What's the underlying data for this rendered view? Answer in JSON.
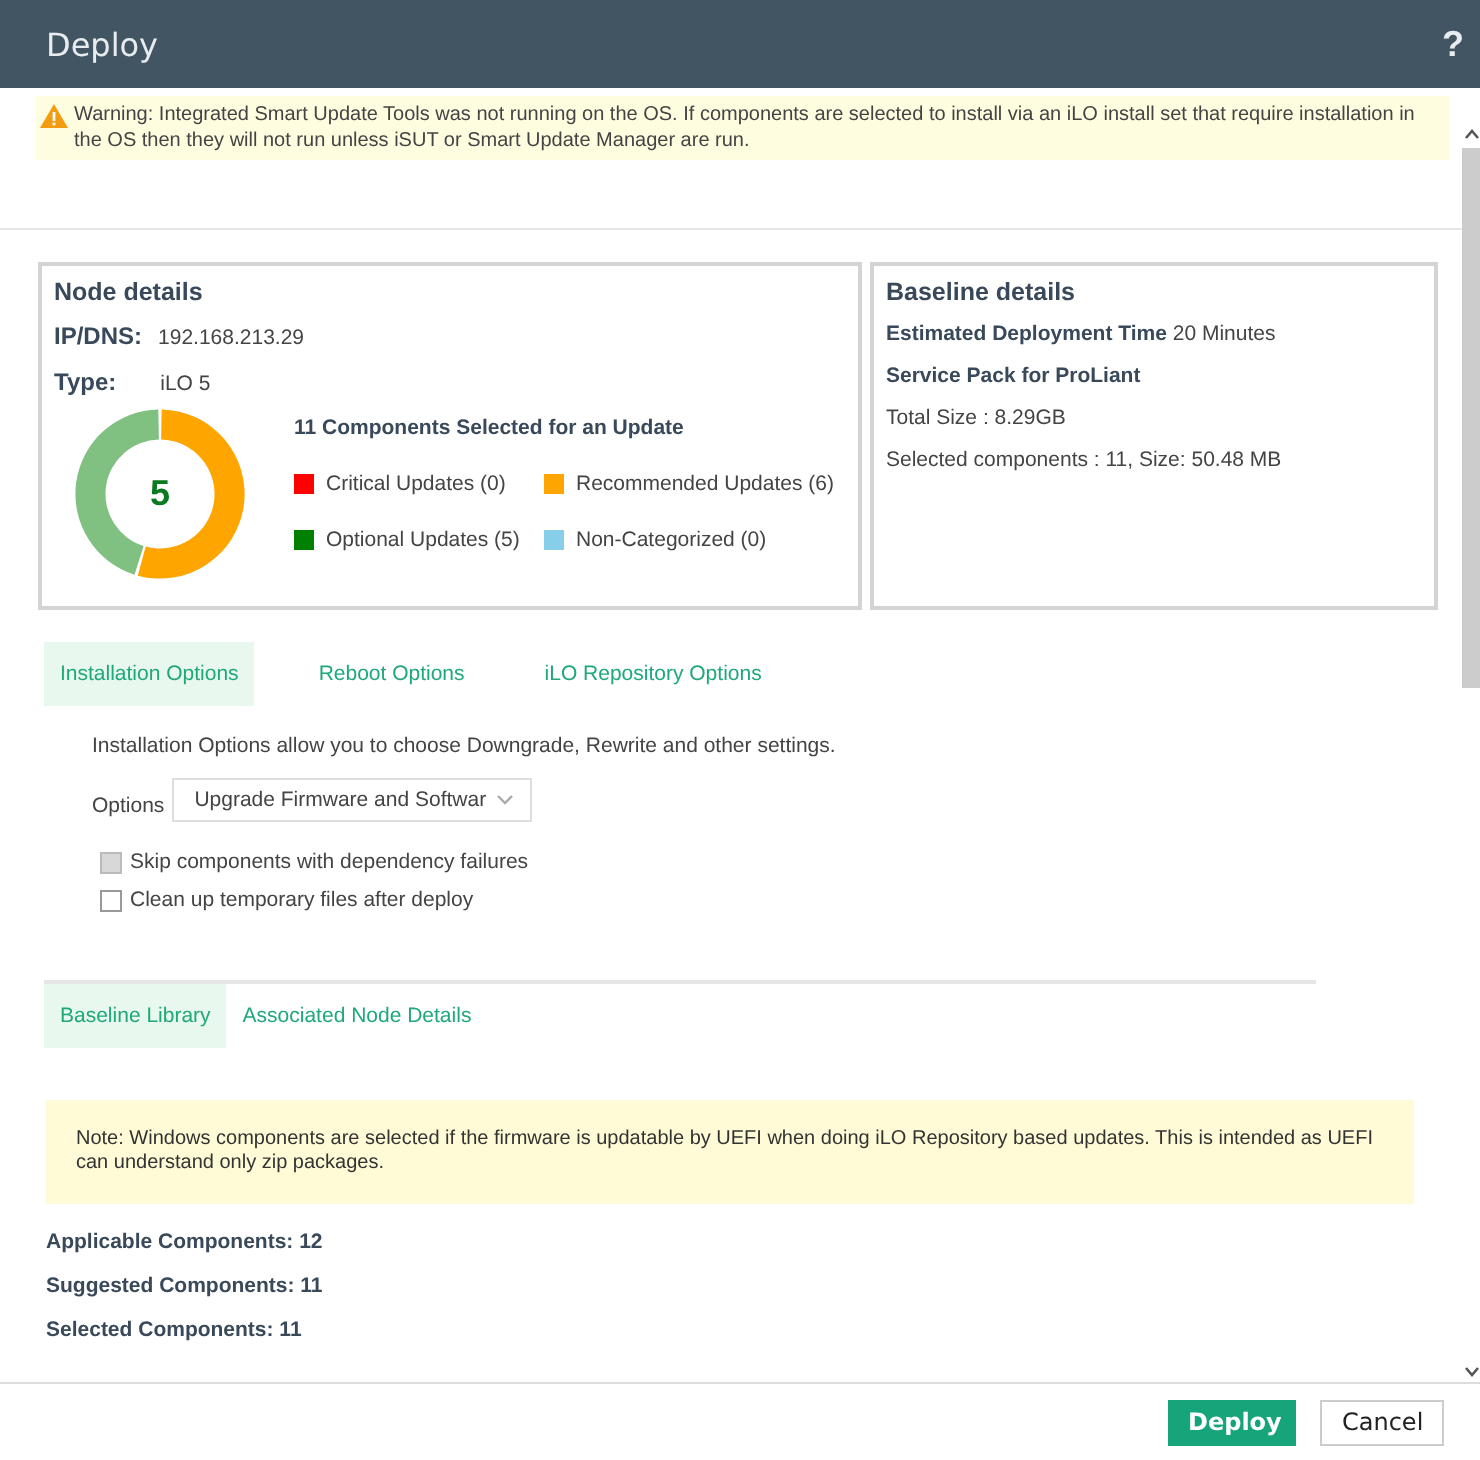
{
  "window": {
    "title": "Deploy",
    "help": "?"
  },
  "warning": "Warning: Integrated Smart Update Tools was not running on the OS. If components are selected to install via an iLO install set that require installation in the OS then they will not run unless iSUT or Smart Update Manager are run.",
  "node_details": {
    "title": "Node details",
    "ip_label": "IP/DNS:",
    "ip": "192.168.213.29",
    "type_label": "Type:",
    "type": "iLO 5",
    "donut_center": "5",
    "summary": "11 Components Selected for an Update",
    "legend": [
      {
        "label": "Critical Updates (0)",
        "color": "#ff0000"
      },
      {
        "label": "Recommended Updates (6)",
        "color": "#ffa500"
      },
      {
        "label": "Optional Updates (5)",
        "color": "#008000"
      },
      {
        "label": "Non-Categorized (0)",
        "color": "#87ceeb"
      }
    ]
  },
  "baseline_details": {
    "title": "Baseline details",
    "lines": [
      {
        "kind": "mixed",
        "label": "Estimated Deployment Time",
        "value": "20 Minutes"
      },
      {
        "kind": "bold",
        "label": "Service Pack for ProLiant"
      },
      {
        "kind": "plain",
        "label": "Total Size : 8.29GB"
      },
      {
        "kind": "plain",
        "label": "Selected components : 11, Size: 50.48 MB"
      }
    ]
  },
  "option_tabs": [
    {
      "label": "Installation Options",
      "selected": true
    },
    {
      "label": "Reboot Options",
      "selected": false
    },
    {
      "label": "iLO Repository Options",
      "selected": false
    }
  ],
  "installation_options": {
    "description": "Installation Options allow you to choose Downgrade, Rewrite and other settings.",
    "options_label": "Options",
    "options_value": "Upgrade Firmware and Softwar",
    "checkboxes": [
      {
        "label": "Skip components with dependency failures",
        "checked": false,
        "disabled": true
      },
      {
        "label": "Clean up temporary files after deploy",
        "checked": false,
        "disabled": false
      }
    ]
  },
  "library_tabs": [
    {
      "label": "Baseline Library",
      "selected": true
    },
    {
      "label": "Associated Node Details",
      "selected": false
    }
  ],
  "note": "Note: Windows components are selected if the firmware is updatable by UEFI when doing iLO Repository based updates. This is intended as UEFI can understand only zip packages.",
  "counts": [
    "Applicable Components: 12",
    "Suggested Components: 11",
    "Selected Components: 11"
  ],
  "buttons": [
    {
      "label": "Deploy",
      "kind": "primary"
    },
    {
      "label": "Cancel",
      "kind": "secondary"
    }
  ]
}
